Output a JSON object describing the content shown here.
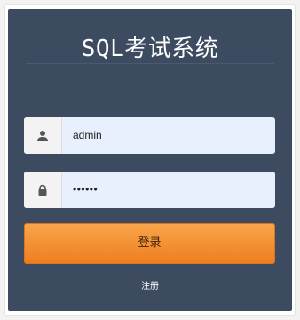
{
  "title": "SQL考试系统",
  "username": {
    "icon": "user-icon",
    "value": "admin"
  },
  "password": {
    "icon": "lock-icon",
    "value": "••••••"
  },
  "login_label": "登录",
  "register_label": "注册",
  "colors": {
    "panel": "#3d4b60",
    "input_bg": "#e8f0fe",
    "button": "#f0882e"
  }
}
